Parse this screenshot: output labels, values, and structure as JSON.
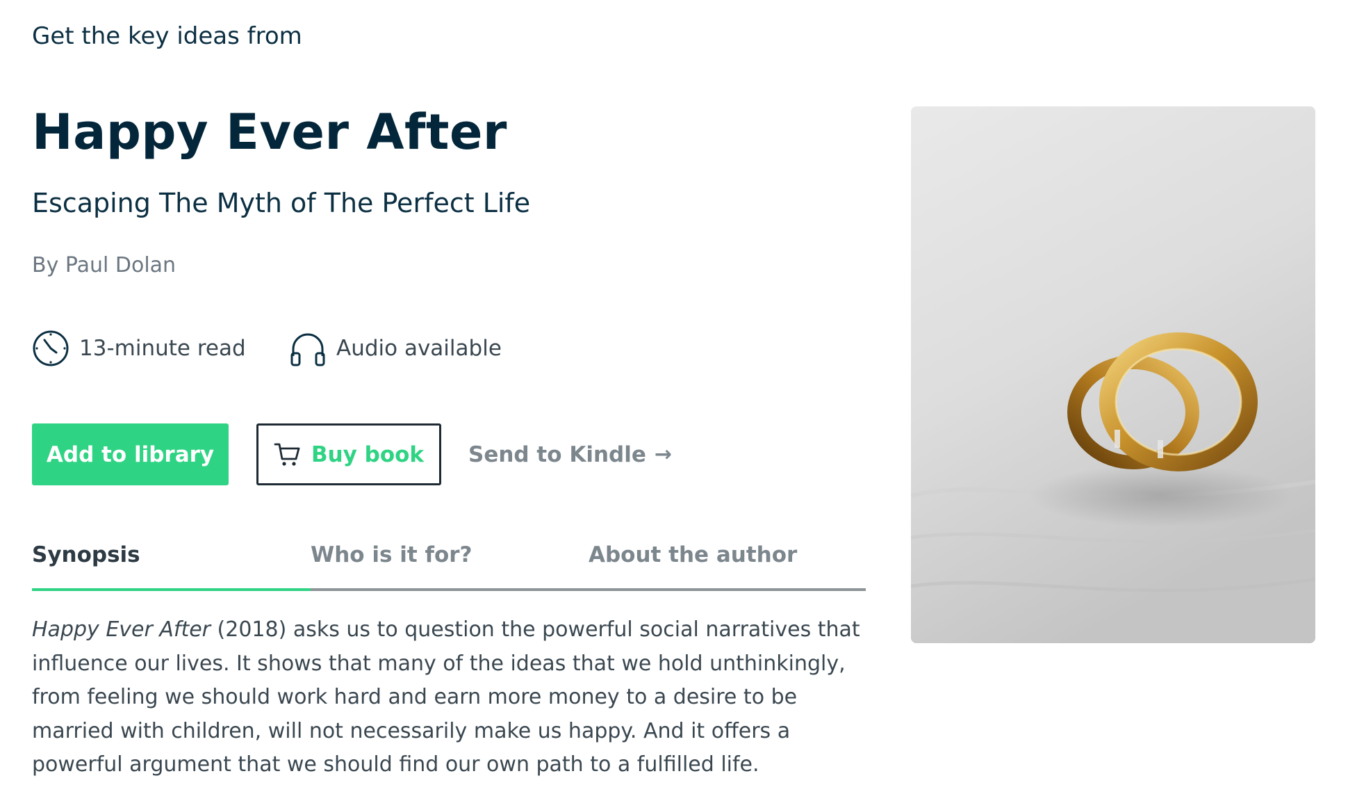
{
  "header": {
    "eyebrow": "Get the key ideas from"
  },
  "book": {
    "title": "Happy Ever After",
    "subtitle": "Escaping The Myth of The Perfect Life",
    "author": "By Paul Dolan"
  },
  "meta": {
    "read_time": "13-minute read",
    "read_icon": "clock-icon",
    "audio": "Audio available",
    "audio_icon": "headphones-icon"
  },
  "actions": {
    "add_label": "Add to library",
    "buy_label": "Buy book",
    "buy_icon": "cart-icon",
    "kindle_label": "Send to Kindle",
    "kindle_arrow": "→"
  },
  "tabs": [
    {
      "label": "Synopsis",
      "active": true
    },
    {
      "label": "Who is it for?",
      "active": false
    },
    {
      "label": "About the author",
      "active": false
    }
  ],
  "synopsis": {
    "book_title": "Happy Ever After",
    "text": " (2018) asks us to question the powerful social narratives that influence our lives. It shows that many of the ideas that we hold unthinkingly, from feeling we should work hard and earn more money to a desire to be married with children, will not necessarily make us happy. And it offers a powerful argument that we should find our own path to a fulfilled life."
  },
  "cover": {
    "image": "wedding-rings-on-fabric"
  },
  "colors": {
    "accent": "#2ed383",
    "title": "#03263a",
    "muted": "#7c868d"
  }
}
